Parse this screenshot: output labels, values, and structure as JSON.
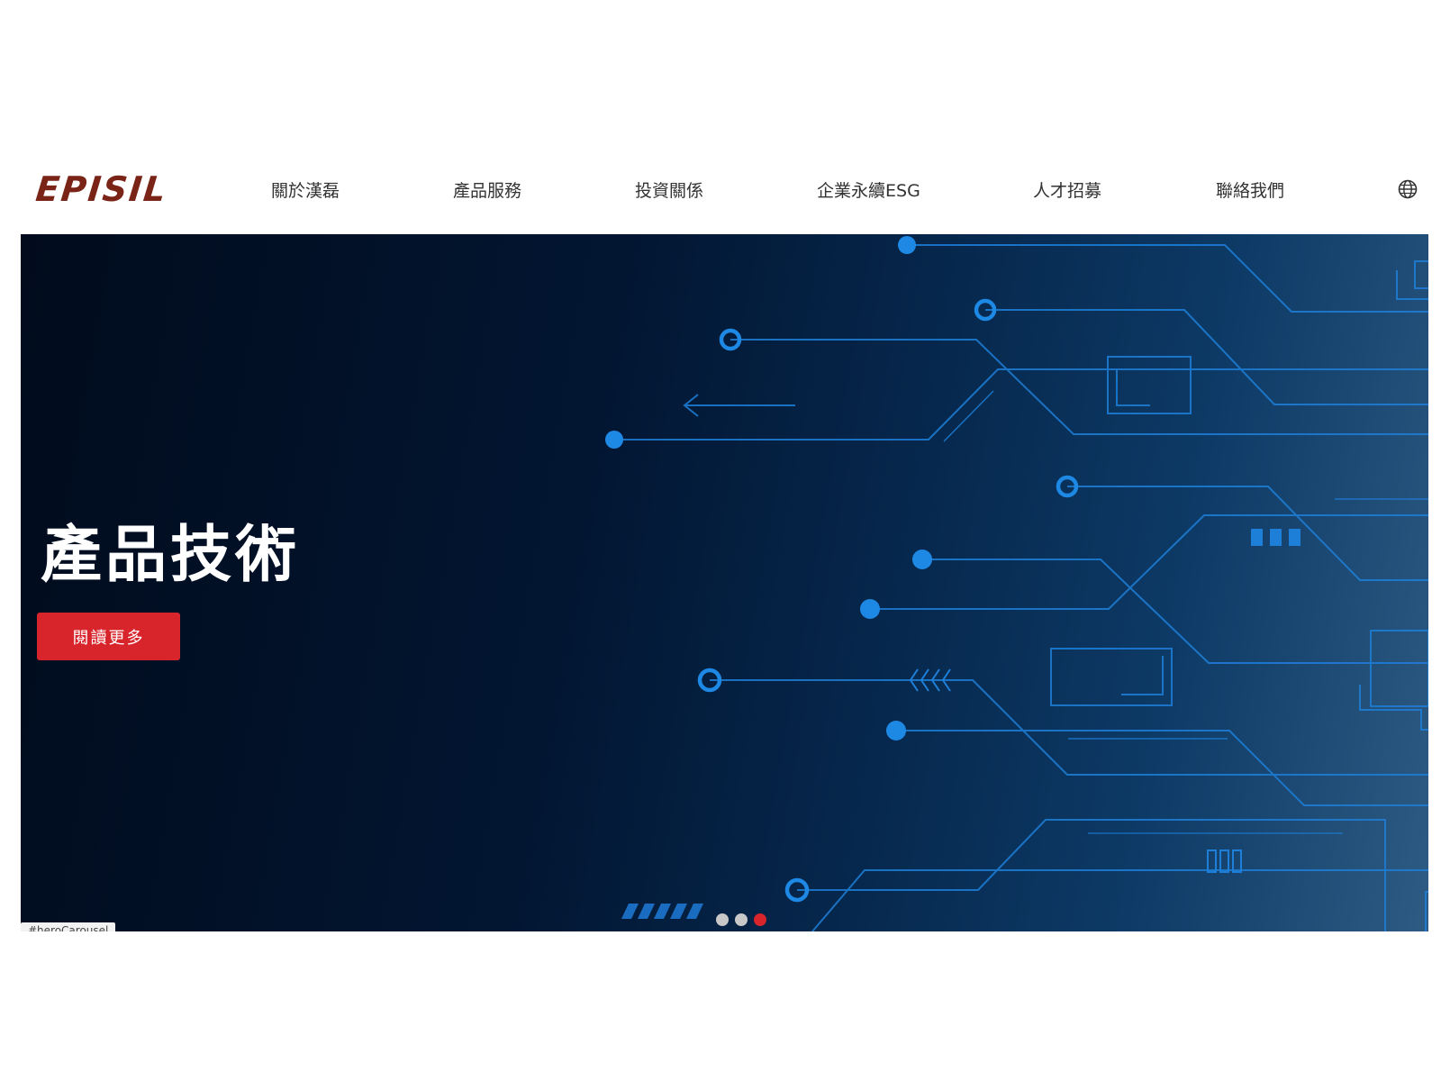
{
  "header": {
    "logo_text": "EPISIL",
    "nav": [
      {
        "label": "關於漢磊"
      },
      {
        "label": "產品服務"
      },
      {
        "label": "投資關係"
      },
      {
        "label": "企業永續ESG"
      },
      {
        "label": "人才招募"
      },
      {
        "label": "聯絡我們"
      }
    ],
    "language_icon": "globe-icon"
  },
  "hero": {
    "title": "產品技術",
    "button_label": "閱讀更多",
    "carousel_tag": "#heroCarousel",
    "slides_total": 3,
    "active_slide": 3
  },
  "colors": {
    "logo": "#7a2418",
    "accent_red": "#d8242b",
    "dot_inactive": "#c8c8c8",
    "dot_active": "#d8242b",
    "circuit": "#1e88e5",
    "nav_text": "#333333"
  }
}
